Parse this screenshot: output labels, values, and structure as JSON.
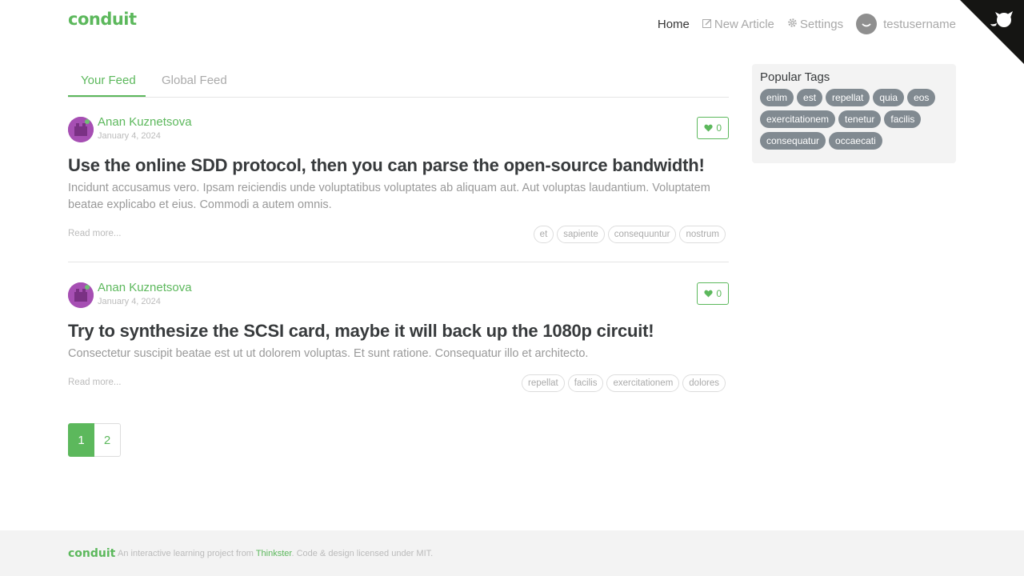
{
  "nav": {
    "brand": "conduit",
    "home": "Home",
    "new_article": "New Article",
    "settings": "Settings",
    "username": "testusername"
  },
  "feed": {
    "tabs": [
      "Your Feed",
      "Global Feed"
    ],
    "active_tab": "Your Feed"
  },
  "articles": [
    {
      "author": "Anan Kuznetsova",
      "date": "January 4, 2024",
      "favorites": "0",
      "title": "Use the online SDD protocol, then you can parse the open-source bandwidth!",
      "description": "Incidunt accusamus vero. Ipsam reiciendis unde voluptatibus voluptates ab aliquam aut. Aut voluptas laudantium. Voluptatem beatae explicabo et eius. Commodi a autem omnis.",
      "read_more": "Read more...",
      "tags": [
        "et",
        "sapiente",
        "consequuntur",
        "nostrum"
      ]
    },
    {
      "author": "Anan Kuznetsova",
      "date": "January 4, 2024",
      "favorites": "0",
      "title": "Try to synthesize the SCSI card, maybe it will back up the 1080p circuit!",
      "description": "Consectetur suscipit beatae est ut ut dolorem voluptas. Et sunt ratione. Consequatur illo et architecto.",
      "read_more": "Read more...",
      "tags": [
        "repellat",
        "facilis",
        "exercitationem",
        "dolores"
      ]
    }
  ],
  "pagination": {
    "pages": [
      "1",
      "2"
    ],
    "current": "1"
  },
  "sidebar": {
    "title": "Popular Tags",
    "tags": [
      "enim",
      "est",
      "repellat",
      "quia",
      "eos",
      "exercitationem",
      "tenetur",
      "facilis",
      "consequatur",
      "occaecati"
    ]
  },
  "footer": {
    "brand": "conduit",
    "text_before": "An interactive learning project from",
    "link": "Thinkster",
    "text_after": ". Code & design licensed under MIT."
  },
  "colors": {
    "accent": "#5cb85c",
    "tag_pill": "#818a91",
    "avatar": "#a64fb3",
    "footer_bg": "#f3f3f3"
  },
  "icons": {
    "new_article": "pencil-square-icon",
    "settings": "gear-icon",
    "favorite": "heart-icon",
    "corner": "github-octocat-icon"
  }
}
